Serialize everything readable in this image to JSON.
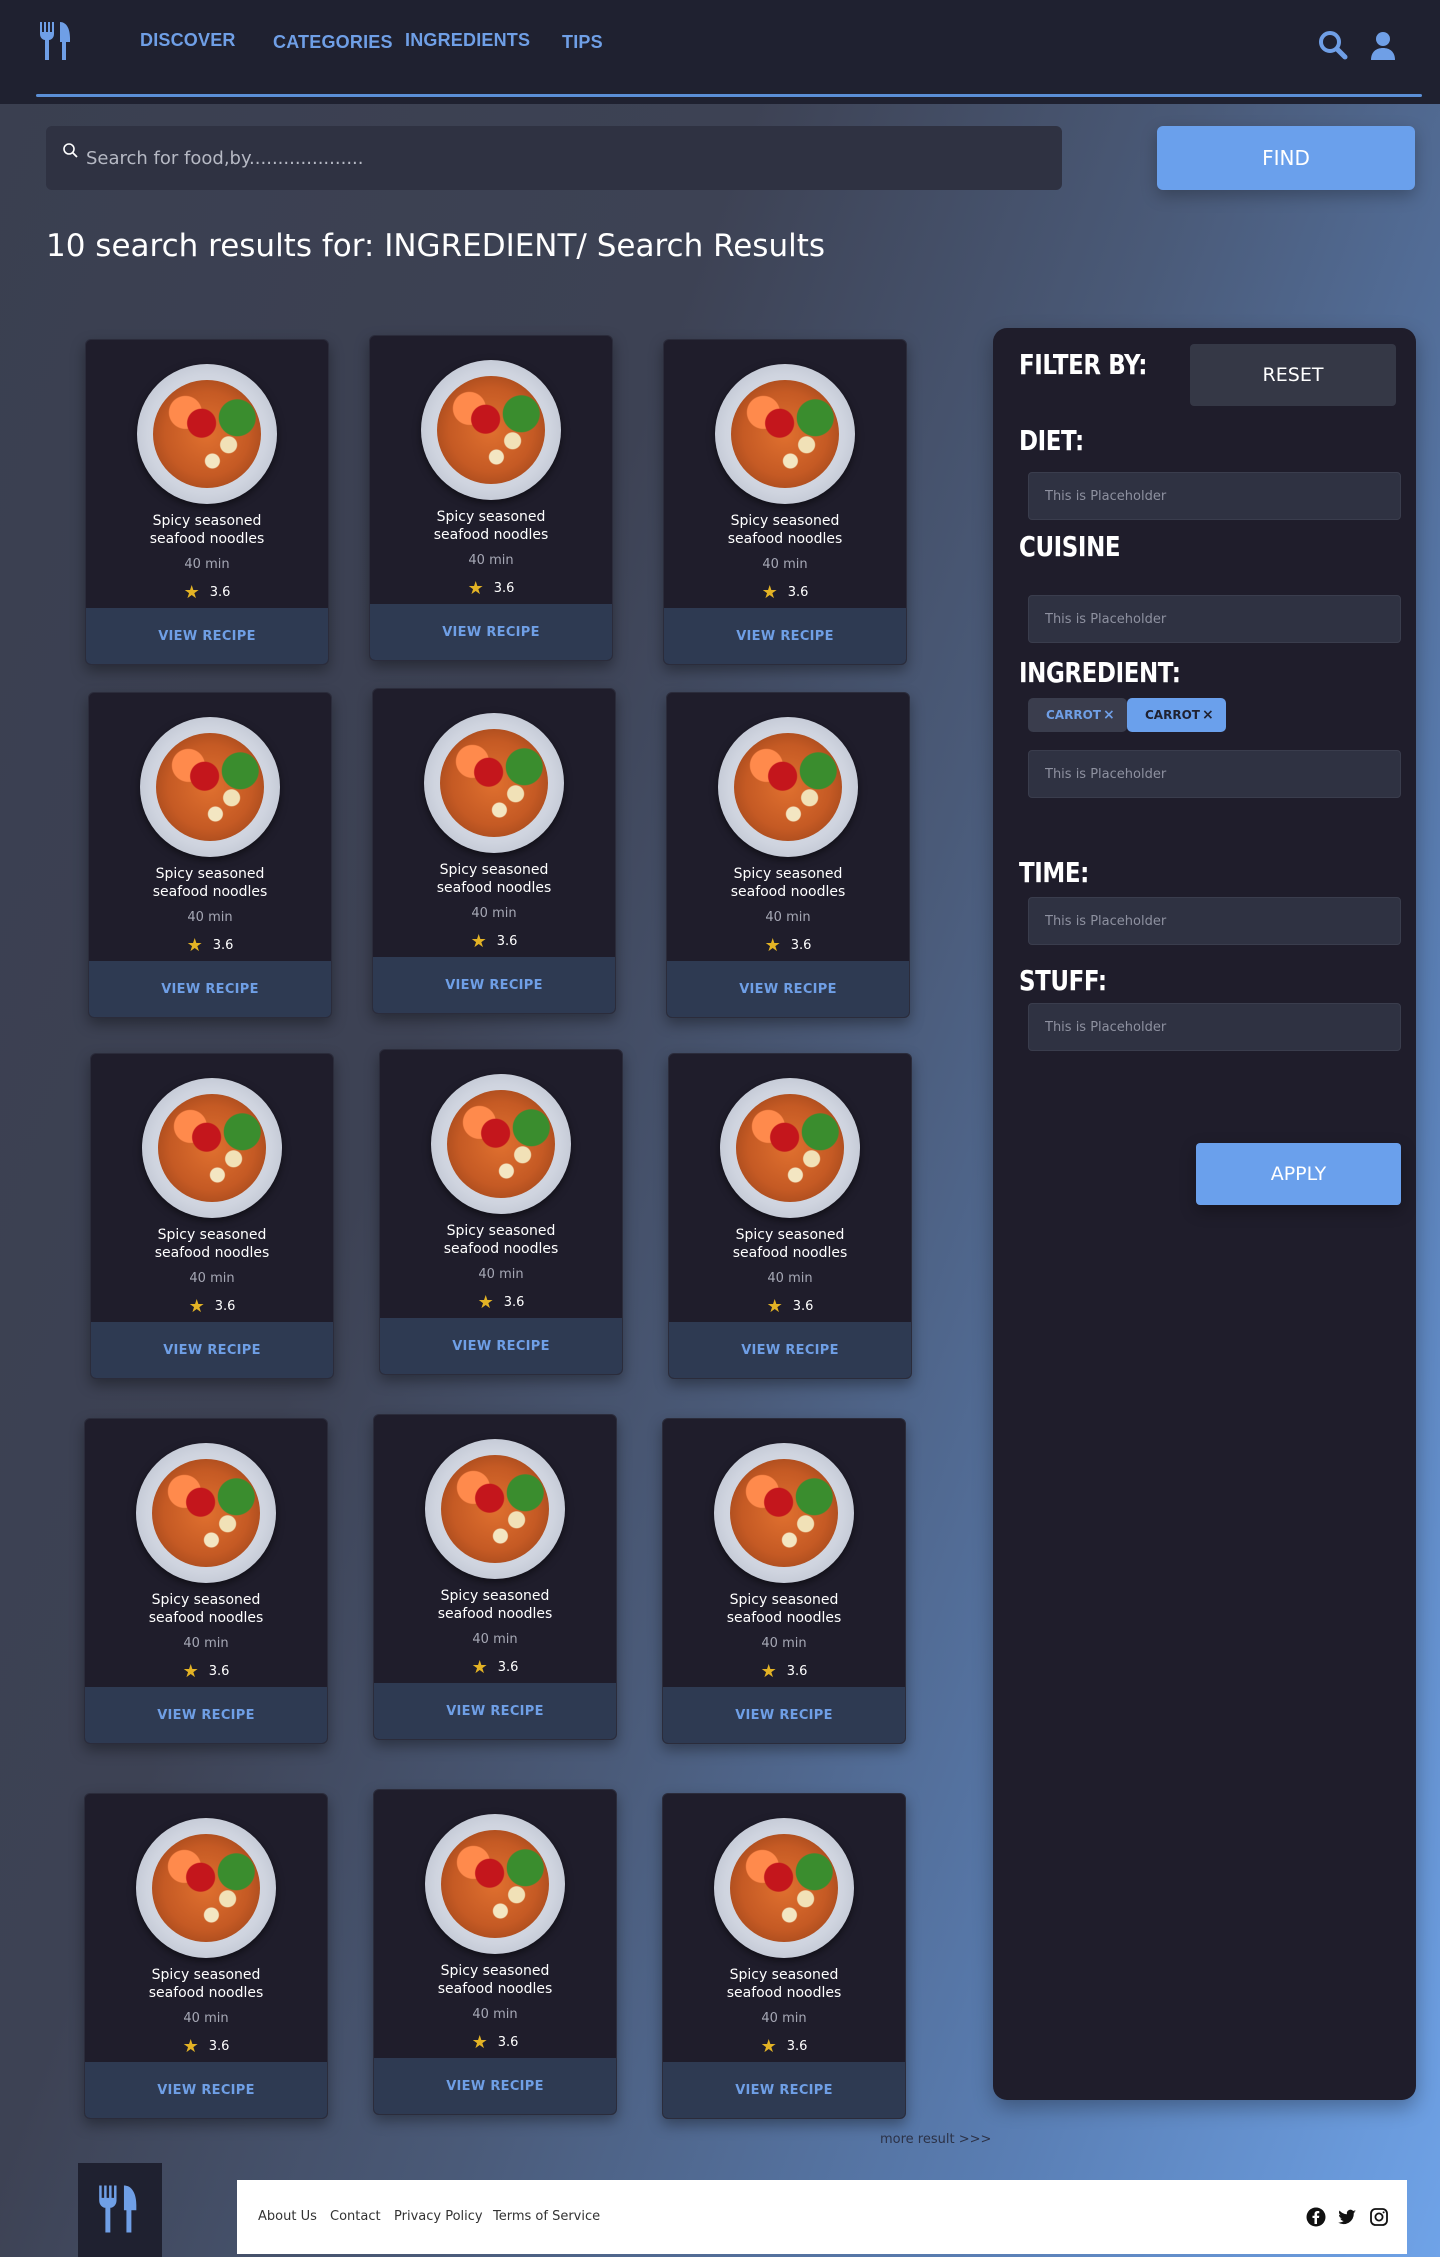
{
  "header": {
    "nav": [
      "DISCOVER",
      "CATEGORIES",
      "INGREDIENTS",
      "TIPS"
    ]
  },
  "search": {
    "placeholder": "Search for food,by....................",
    "button": "FIND"
  },
  "results_title": "10 search results for: INGREDIENT/ Search Results",
  "cards": [
    {
      "name": "Spicy seasoned seafood noodles",
      "time": "40 min",
      "rating": "3.6",
      "button": "VIEW RECIPE"
    },
    {
      "name": "Spicy seasoned seafood noodles",
      "time": "40 min",
      "rating": "3.6",
      "button": "VIEW RECIPE"
    },
    {
      "name": "Spicy seasoned seafood noodles",
      "time": "40 min",
      "rating": "3.6",
      "button": "VIEW RECIPE"
    },
    {
      "name": "Spicy seasoned seafood noodles",
      "time": "40 min",
      "rating": "3.6",
      "button": "VIEW RECIPE"
    },
    {
      "name": "Spicy seasoned seafood noodles",
      "time": "40 min",
      "rating": "3.6",
      "button": "VIEW RECIPE"
    },
    {
      "name": "Spicy seasoned seafood noodles",
      "time": "40 min",
      "rating": "3.6",
      "button": "VIEW RECIPE"
    },
    {
      "name": "Spicy seasoned seafood noodles",
      "time": "40 min",
      "rating": "3.6",
      "button": "VIEW RECIPE"
    },
    {
      "name": "Spicy seasoned seafood noodles",
      "time": "40 min",
      "rating": "3.6",
      "button": "VIEW RECIPE"
    },
    {
      "name": "Spicy seasoned seafood noodles",
      "time": "40 min",
      "rating": "3.6",
      "button": "VIEW RECIPE"
    },
    {
      "name": "Spicy seasoned seafood noodles",
      "time": "40 min",
      "rating": "3.6",
      "button": "VIEW RECIPE"
    },
    {
      "name": "Spicy seasoned seafood noodles",
      "time": "40 min",
      "rating": "3.6",
      "button": "VIEW RECIPE"
    },
    {
      "name": "Spicy seasoned seafood noodles",
      "time": "40 min",
      "rating": "3.6",
      "button": "VIEW RECIPE"
    },
    {
      "name": "Spicy seasoned seafood noodles",
      "time": "40 min",
      "rating": "3.6",
      "button": "VIEW RECIPE"
    },
    {
      "name": "Spicy seasoned seafood noodles",
      "time": "40 min",
      "rating": "3.6",
      "button": "VIEW RECIPE"
    },
    {
      "name": "Spicy seasoned seafood noodles",
      "time": "40 min",
      "rating": "3.6",
      "button": "VIEW RECIPE"
    }
  ],
  "filter": {
    "title": "FILTER BY:",
    "reset": "RESET",
    "diet": {
      "label": "DIET:",
      "placeholder": "This is Placeholder"
    },
    "cuisine": {
      "label": "CUISINE",
      "placeholder": "This is Placeholder"
    },
    "ingredient": {
      "label": "INGREDIENT:",
      "placeholder": "This is Placeholder",
      "chips": [
        "CARROT",
        "CARROT"
      ],
      "chip_remove": "×"
    },
    "time": {
      "label": "TIME:",
      "placeholder": "This is Placeholder"
    },
    "stuff": {
      "label": "STUFF:",
      "placeholder": "This is Placeholder"
    },
    "apply": "APPLY"
  },
  "more_results": "more result >>>",
  "footer": {
    "links": [
      "About Us",
      "Contact",
      "Privacy Policy",
      "Terms of Service"
    ],
    "social_icons": [
      "facebook-icon",
      "twitter-icon",
      "instagram-icon"
    ]
  },
  "colors": {
    "accent": "#6aa0ec",
    "nav": "#6f9fe6",
    "card_bg": "#1f1d2b",
    "star": "#e3b325"
  }
}
